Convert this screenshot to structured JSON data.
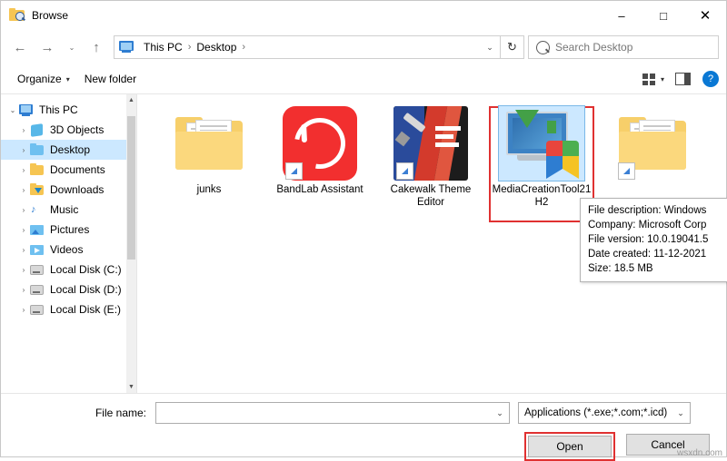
{
  "window": {
    "title": "Browse",
    "icon": "browse-folder-search-icon",
    "controls": {
      "minimize": "–",
      "maximize": "□",
      "close": "✕"
    }
  },
  "nav": {
    "back": "←",
    "forward": "→",
    "up": "↑",
    "refresh": "↻",
    "breadcrumb": [
      "This PC",
      "Desktop"
    ],
    "breadcrumb_separator": "›",
    "dropdown": "⌄"
  },
  "search": {
    "placeholder": "Search Desktop",
    "value": ""
  },
  "command_bar": {
    "organize": "Organize",
    "new_folder": "New folder",
    "view_caret": "▾",
    "help": "?"
  },
  "sidebar": {
    "items": [
      {
        "label": "This PC",
        "icon": "computer-icon",
        "twisty": "⌄",
        "indent": 0,
        "selected": false
      },
      {
        "label": "3D Objects",
        "icon": "3d-objects-icon",
        "twisty": "›",
        "indent": 1,
        "selected": false
      },
      {
        "label": "Desktop",
        "icon": "desktop-folder-icon",
        "twisty": "›",
        "indent": 1,
        "selected": true
      },
      {
        "label": "Documents",
        "icon": "documents-folder-icon",
        "twisty": "›",
        "indent": 1,
        "selected": false
      },
      {
        "label": "Downloads",
        "icon": "downloads-folder-icon",
        "twisty": "›",
        "indent": 1,
        "selected": false
      },
      {
        "label": "Music",
        "icon": "music-folder-icon",
        "twisty": "›",
        "indent": 1,
        "selected": false
      },
      {
        "label": "Pictures",
        "icon": "pictures-folder-icon",
        "twisty": "›",
        "indent": 1,
        "selected": false
      },
      {
        "label": "Videos",
        "icon": "videos-folder-icon",
        "twisty": "›",
        "indent": 1,
        "selected": false
      },
      {
        "label": "Local Disk (C:)",
        "icon": "disk-drive-icon",
        "twisty": "›",
        "indent": 1,
        "selected": false
      },
      {
        "label": "Local Disk (D:)",
        "icon": "disk-drive-icon",
        "twisty": "›",
        "indent": 1,
        "selected": false
      },
      {
        "label": "Local Disk (E:)",
        "icon": "disk-drive-icon",
        "twisty": "›",
        "indent": 1,
        "selected": false
      }
    ]
  },
  "files": [
    {
      "name": "junks",
      "type": "folder",
      "shortcut": false,
      "selected": false
    },
    {
      "name": "BandLab Assistant",
      "type": "app-bandlab",
      "shortcut": true,
      "selected": false
    },
    {
      "name": "Cakewalk Theme Editor",
      "type": "app-cakewalk",
      "shortcut": true,
      "selected": false
    },
    {
      "name": "MediaCreationTool21H2",
      "type": "app-mediacreationtool",
      "shortcut": false,
      "selected": true
    },
    {
      "name": "",
      "type": "folder",
      "shortcut": true,
      "selected": false
    }
  ],
  "tooltip": {
    "lines": [
      "File description: Windows",
      "Company: Microsoft Corp",
      "File version: 10.0.19041.5",
      "Date created: 11-12-2021",
      "Size: 18.5 MB"
    ]
  },
  "footer": {
    "file_name_label": "File name:",
    "file_name_value": "",
    "file_name_dropdown": "⌄",
    "filter_value": "Applications (*.exe;*.com;*.icd)",
    "filter_dropdown": "⌄",
    "open_button": "Open",
    "cancel_button": "Cancel"
  },
  "watermark": "wsxdn.com",
  "colors": {
    "selection": "#cce8ff",
    "highlight_outline": "#e03131",
    "accent_blue": "#0a78d4"
  }
}
